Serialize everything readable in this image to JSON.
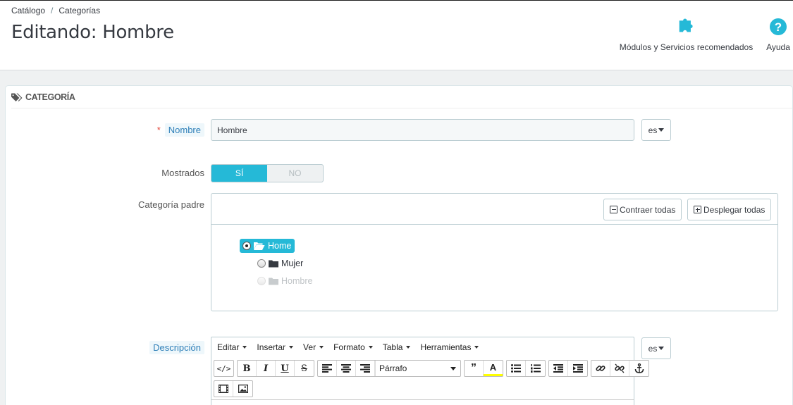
{
  "breadcrumb": {
    "items": [
      "Catálogo",
      "Categorías"
    ],
    "separator": "/"
  },
  "page": {
    "title": "Editando: Hombre"
  },
  "toolbar": {
    "modules_label": "Módulos y Servicios recomendados",
    "help_label": "Ayuda",
    "icon_color": "#25b9d7"
  },
  "panel": {
    "heading": "CATEGORÍA"
  },
  "form": {
    "name": {
      "label": "Nombre",
      "value": "Hombre",
      "lang": "es"
    },
    "displayed": {
      "label": "Mostrados",
      "on_label": "SÍ",
      "off_label": "NO",
      "value": "SÍ"
    },
    "parent": {
      "label": "Categoría padre",
      "collapse_label": "Contraer todas",
      "expand_label": "Desplegar todas",
      "tree": [
        {
          "label": "Home",
          "selected": true
        },
        {
          "label": "Mujer",
          "selected": false
        },
        {
          "label": "Hombre",
          "selected": false,
          "disabled": true
        }
      ]
    },
    "description": {
      "label": "Descripción",
      "lang": "es",
      "menu": [
        "Editar",
        "Insertar",
        "Ver",
        "Formato",
        "Tabla",
        "Herramientas"
      ],
      "format_value": "Párrafo"
    }
  },
  "colors": {
    "accent": "#25b9d7",
    "required": "#e3483c",
    "label_hint_bg": "#eef7fb",
    "label_hint_fg": "#2e7fb8"
  }
}
